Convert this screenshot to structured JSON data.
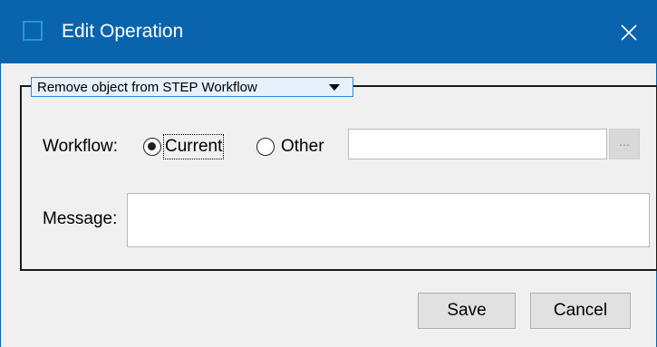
{
  "window": {
    "title": "Edit Operation",
    "close_glyph": "✕"
  },
  "operation": {
    "selected": "Remove object from STEP Workflow"
  },
  "workflow": {
    "label": "Workflow:",
    "options": [
      {
        "label": "Current",
        "selected": true
      },
      {
        "label": "Other",
        "selected": false
      }
    ],
    "other_value": "",
    "browse_label": "..."
  },
  "message": {
    "label": "Message:",
    "value": ""
  },
  "buttons": {
    "save": "Save",
    "cancel": "Cancel"
  },
  "colors": {
    "titlebar": "#0a64ad",
    "accent": "#2b8ad8"
  },
  "icons": {
    "app": "window-icon",
    "close": "close-icon",
    "dropdown": "chevron-down-icon"
  }
}
